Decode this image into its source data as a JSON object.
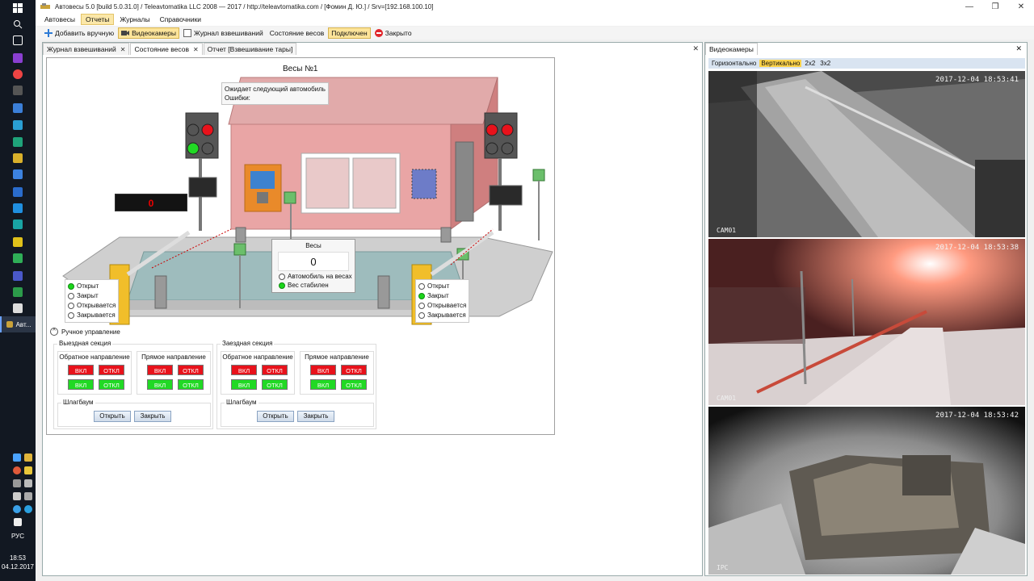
{
  "window": {
    "title": "Автовесы 5.0 [build 5.0.31.0] / Teleavtomatika LLC 2008 — 2017 / http://teleavtomatika.com / [Фомин Д. Ю.] / Srv=[192.168.100.10]",
    "minimize": "—",
    "maximize": "❐",
    "close": "✕"
  },
  "menu": [
    "Автовесы",
    "Отчеты",
    "Журналы",
    "Справочники"
  ],
  "toolbar": {
    "add_manual": "Добавить вручную",
    "cameras": "Видеокамеры",
    "weigh_journal": "Журнал взвешиваний",
    "scale_state": "Состояние весов",
    "connected": "Подключен",
    "closed": "Закрыто"
  },
  "tabs": [
    "Журнал взвешиваний",
    "Состояние весов",
    "Отчет [Взвешивание тары]"
  ],
  "close_glyph": "✕",
  "scale": {
    "title": "Весы №1",
    "status_line1": "Ожидает следующий автомобиль",
    "status_line2": "Ошибки:",
    "weight_label": "Весы",
    "weight_value": "0",
    "vehicle_on_scale": "Автомобиль на весах",
    "weight_stable": "Вес стабилен",
    "led_value": "0"
  },
  "barrier_left": {
    "opened": "Открыт",
    "closed": "Закрыт",
    "opening": "Открывается",
    "closing": "Закрывается"
  },
  "barrier_right": {
    "opened": "Открыт",
    "closed": "Закрыт",
    "opening": "Открывается",
    "closing": "Закрывается"
  },
  "manual": {
    "title": "Ручное управление",
    "collapse": "^",
    "exit_section": "Выездная секция",
    "entry_section": "Заездная секция",
    "reverse_dir": "Обратное направление",
    "forward_dir": "Прямое направление",
    "on": "ВКЛ",
    "off": "ОТКЛ",
    "barrier": "Шлагбаум",
    "open": "Открыть",
    "close": "Закрыть"
  },
  "cameras": {
    "tab": "Видеокамеры",
    "layouts": [
      "Горизонтально",
      "Вертикально",
      "2x2",
      "3x2"
    ],
    "active_layout": "Вертикально",
    "views": [
      {
        "timestamp": "2017-12-04 18:53:41",
        "name": "CAM01"
      },
      {
        "timestamp": "2017-12-04 18:53:38",
        "name": "CAM01"
      },
      {
        "timestamp": "2017-12-04 18:53:42",
        "name": "IPC"
      }
    ]
  },
  "taskbar": {
    "app_label": "Авт...",
    "lang": "РУС",
    "time": "18:53",
    "date": "04.12.2017"
  },
  "colors": {
    "accent": "#fbd24a",
    "led_red": "#e8121b",
    "led_green": "#21d924",
    "building": "#e9a5a5"
  }
}
